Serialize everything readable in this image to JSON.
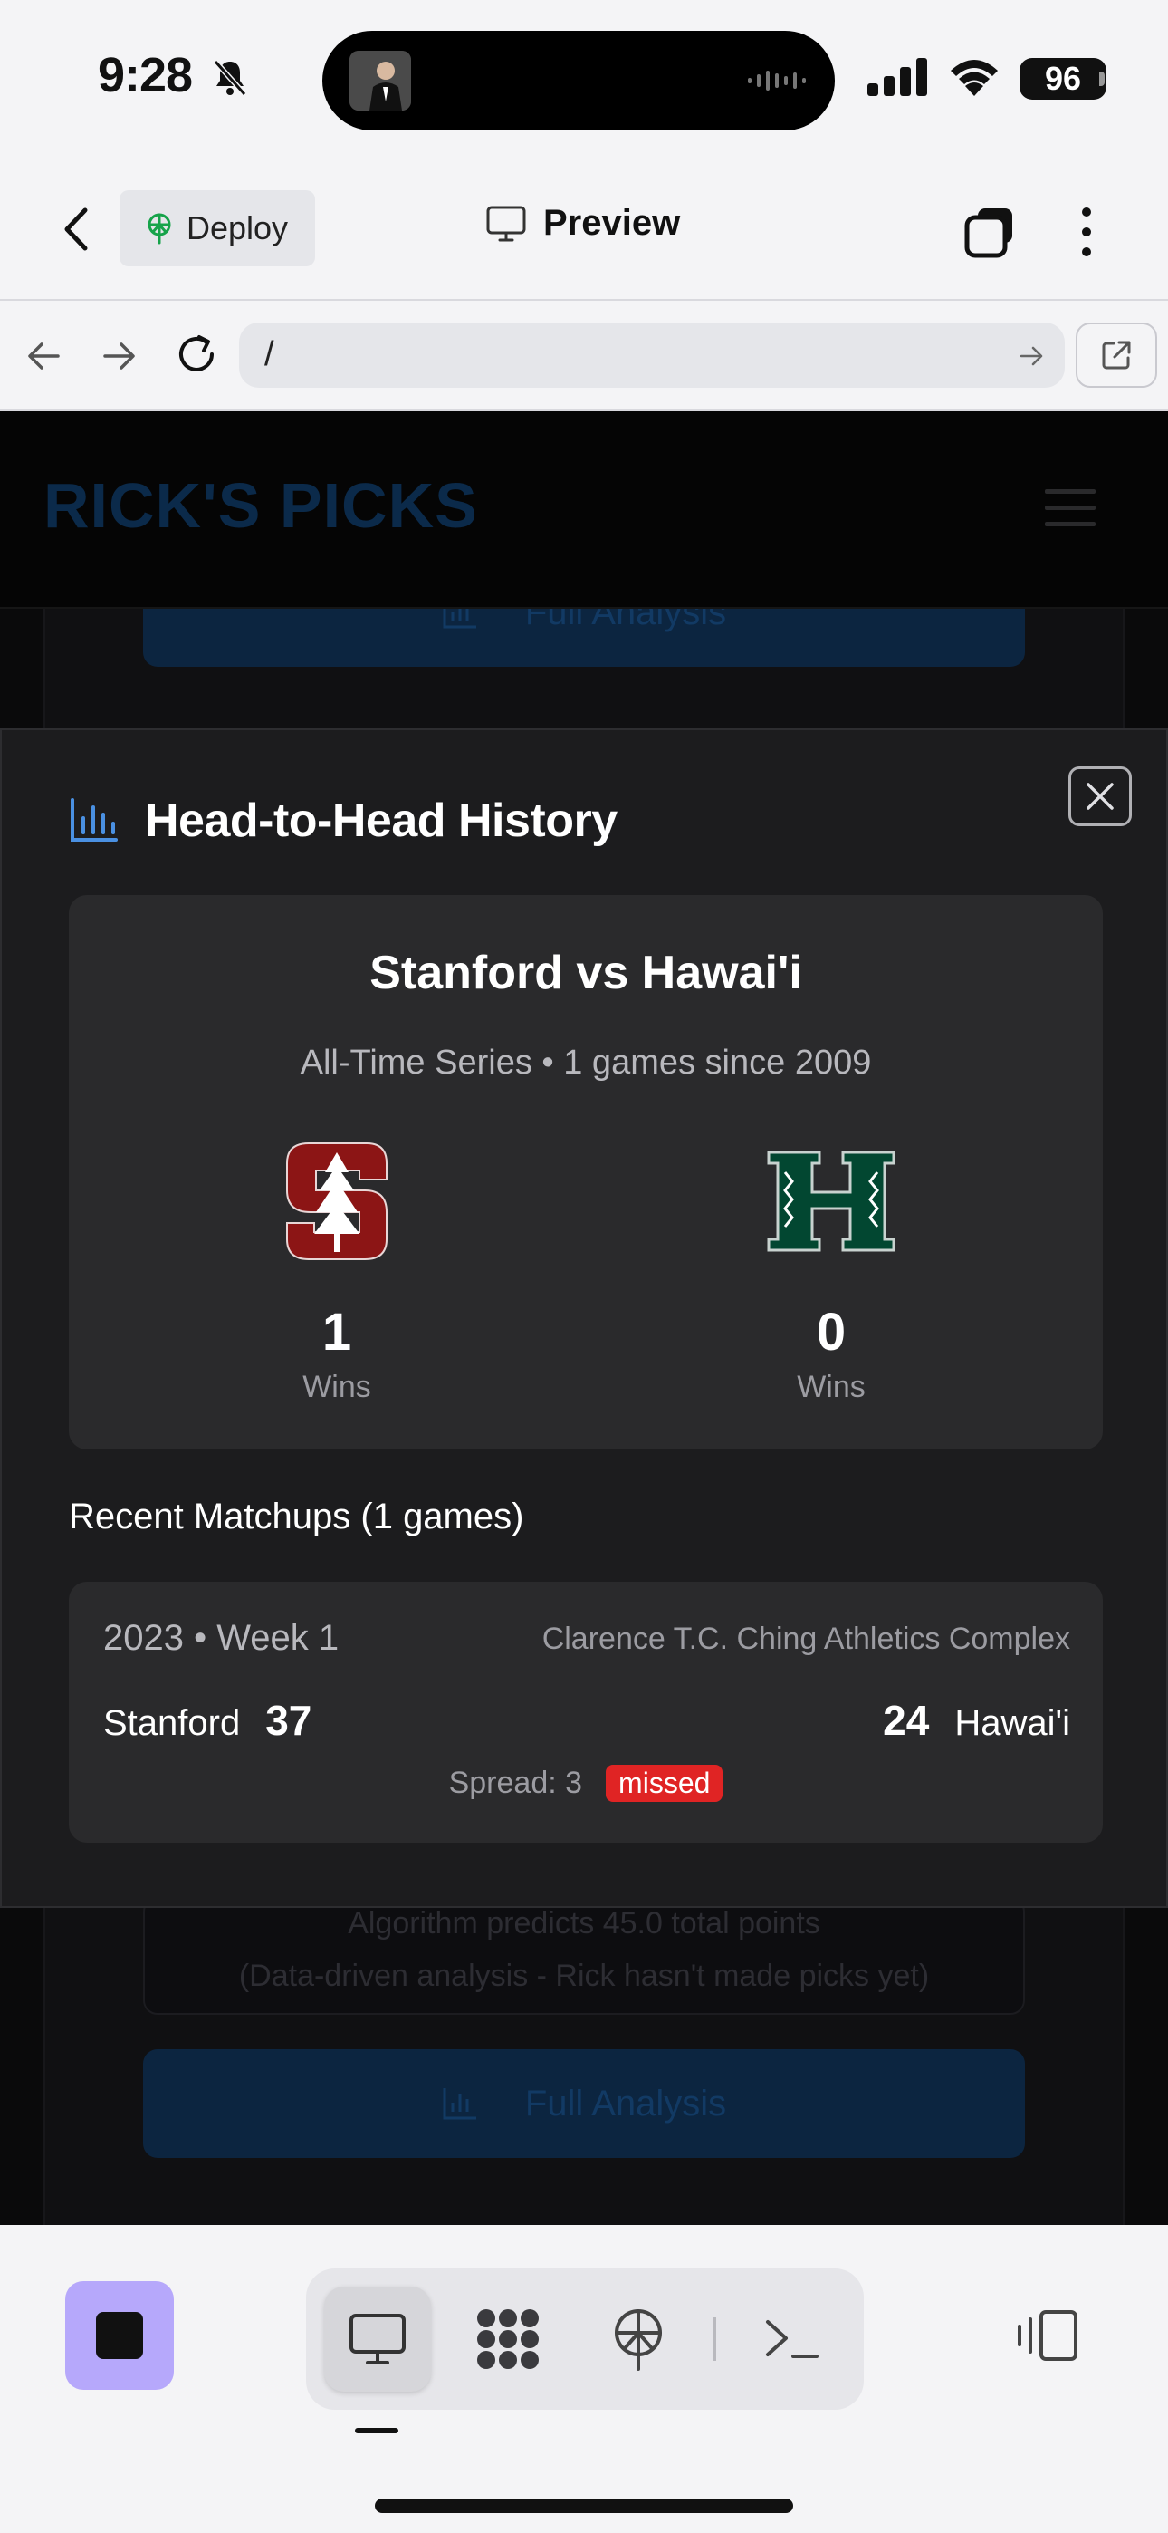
{
  "status_bar": {
    "time": "9:28",
    "battery": "96",
    "icons": [
      "bell-slash-icon",
      "signal-icon",
      "wifi-icon",
      "battery-icon"
    ]
  },
  "app_header": {
    "deploy_label": "Deploy",
    "title": "Preview",
    "icons": [
      "chevron-left-icon",
      "globe-tree-icon",
      "monitor-icon",
      "tabs-icon",
      "more-vertical-icon"
    ]
  },
  "url_bar": {
    "url": "/",
    "icons": [
      "arrow-left-icon",
      "arrow-right-icon",
      "reload-icon",
      "arrow-right-small-icon",
      "external-link-icon"
    ]
  },
  "site": {
    "logo": "RICK'S PICKS",
    "full_analysis_label": "Full Analysis",
    "note_line_1": "Algorithm predicts 45.0 total points",
    "note_line_2": "(Data-driven analysis - Rick hasn't made picks yet)"
  },
  "modal": {
    "title": "Head-to-Head History",
    "matchup_title": "Stanford vs Hawai'i",
    "series_subtitle": "All-Time Series • 1 games since 2009",
    "teams": [
      {
        "name": "Stanford",
        "wins": "1",
        "wins_label": "Wins",
        "logo_color": "#8c1515"
      },
      {
        "name": "Hawai'i",
        "wins": "0",
        "wins_label": "Wins",
        "logo_color": "#024731"
      }
    ],
    "recent_heading": "Recent Matchups (1 games)",
    "games": [
      {
        "date": "2023 • Week 1",
        "venue": "Clarence T.C. Ching Athletics Complex",
        "team_a": "Stanford",
        "score_a": "37",
        "team_b": "Hawai'i",
        "score_b": "24",
        "spread": "Spread: 3",
        "result": "missed"
      }
    ]
  },
  "bottom_bar": {
    "tools": [
      "monitor-icon",
      "apps-icon",
      "deploy-icon",
      "terminal-icon"
    ],
    "active_tool": "monitor-icon",
    "colors": {
      "stop_button": "#b6a8fb"
    }
  },
  "colors": {
    "modal_bg": "#1c1c1e",
    "card_bg": "#2a2a2c",
    "accent_blue": "#4a90e2",
    "missed_red": "#e02424"
  }
}
